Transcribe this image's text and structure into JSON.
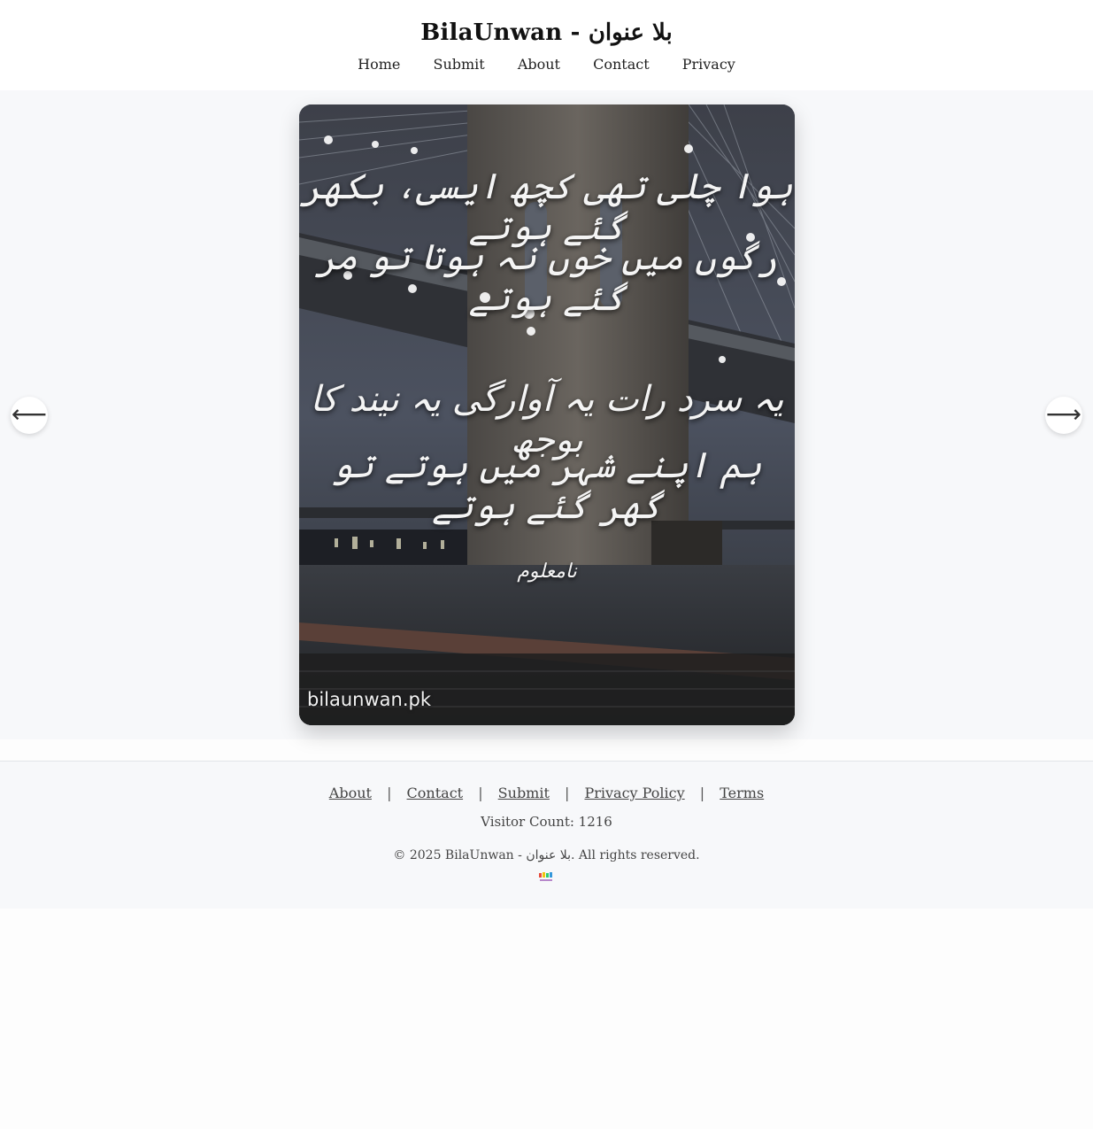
{
  "header": {
    "title": "BilaUnwan - بلا عنوان",
    "nav": [
      "Home",
      "Submit",
      "About",
      "Contact",
      "Privacy"
    ]
  },
  "post": {
    "lines": [
      "ہوا چلی تھی کچھ ایسی، بکھر گئے ہوتے",
      "رگوں میں خوں نہ ہوتا تو مر گئے ہوتے",
      "یہ سرد رات یہ آوارگی یہ نیند کا بوجھ",
      "ہم اپنے شہر میں ہوتے تو گھر گئے ہوتے"
    ],
    "poet": "نامعلوم",
    "watermark": "bilaunwan.pk"
  },
  "carousel": {
    "prev_icon": "arrow-left-icon",
    "next_icon": "arrow-right-icon",
    "prev_glyph": "⟵",
    "next_glyph": "⟶"
  },
  "footer": {
    "links": [
      "About",
      "Contact",
      "Submit",
      "Privacy Policy",
      "Terms"
    ],
    "separator": "|",
    "visitor_count": "Visitor Count: 1216",
    "copyright": "© 2025 BilaUnwan - بلا عنوان. All rights reserved."
  },
  "colors": {
    "page_bg": "#f7f8fa",
    "header_bg": "#ffffff",
    "text": "#222222"
  }
}
